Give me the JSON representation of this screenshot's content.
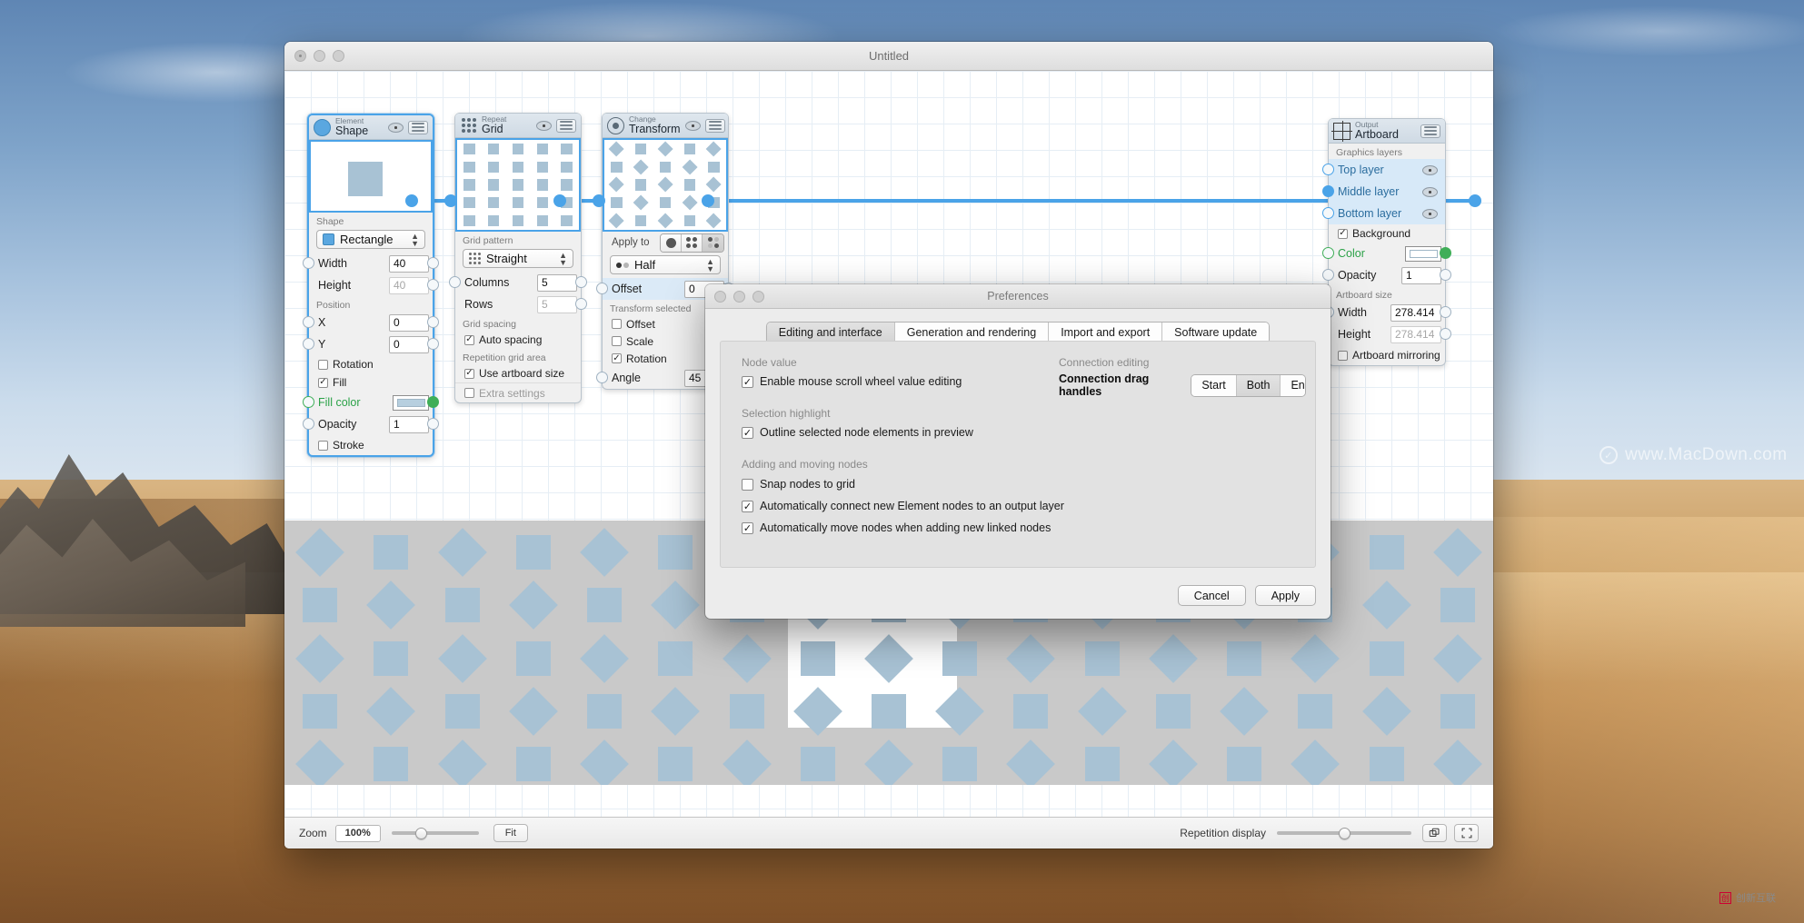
{
  "window": {
    "title": "Untitled",
    "traffic": [
      "close",
      "minimize",
      "zoom"
    ]
  },
  "nodes": [
    {
      "id": "element-shape",
      "kind": "Element",
      "name": "Shape",
      "icon": "circle-icon",
      "selected": true,
      "sections": [
        {
          "label": "Shape"
        }
      ],
      "popup": {
        "label": "Rectangle",
        "icon": "rectangle-swatch-icon"
      },
      "fields": [
        {
          "label": "Width",
          "value": "40",
          "dim": false
        },
        {
          "label": "Height",
          "value": "40",
          "dim": true
        }
      ],
      "position_label": "Position",
      "position_fields": [
        {
          "label": "X",
          "value": "0"
        },
        {
          "label": "Y",
          "value": "0"
        }
      ],
      "checks": [
        {
          "label": "Rotation",
          "checked": false,
          "dim": false
        },
        {
          "label": "Fill",
          "checked": true,
          "dim": false
        }
      ],
      "color_row": {
        "label": "Fill color",
        "green": true
      },
      "opacity_row": {
        "label": "Opacity",
        "value": "1"
      },
      "stroke_row": {
        "label": "Stroke",
        "checked": false
      }
    },
    {
      "id": "repeat-grid",
      "kind": "Repeat",
      "name": "Grid",
      "icon": "grid-dots-icon",
      "selected": false,
      "grid_pattern_label": "Grid pattern",
      "popup": {
        "label": "Straight",
        "icon": "dots-grid-icon"
      },
      "fields": [
        {
          "label": "Columns",
          "value": "5",
          "dim": false
        },
        {
          "label": "Rows",
          "value": "5",
          "dim": true
        }
      ],
      "grid_spacing_label": "Grid spacing",
      "auto_spacing": {
        "label": "Auto spacing",
        "checked": true
      },
      "repetition_area_label": "Repetition grid area",
      "use_artboard": {
        "label": "Use artboard size",
        "checked": true
      },
      "extra_settings": {
        "label": "Extra settings",
        "checked": false,
        "dim": true
      }
    },
    {
      "id": "change-transform",
      "kind": "Change",
      "name": "Transform",
      "icon": "transform-icon",
      "selected": false,
      "apply_to_label": "Apply to",
      "apply_to_options": [
        "all-dot-icon",
        "four-dots-icon",
        "half-dots-icon"
      ],
      "apply_to_selected_index": 2,
      "popup": {
        "label": "Half",
        "icon": "half-dots-icon"
      },
      "offset_row": {
        "label": "Offset",
        "value": "0"
      },
      "transform_selected_label": "Transform selected",
      "checks": [
        {
          "label": "Offset",
          "checked": false
        },
        {
          "label": "Scale",
          "checked": false
        },
        {
          "label": "Rotation",
          "checked": true
        }
      ],
      "angle_row": {
        "label": "Angle",
        "value": "45"
      }
    },
    {
      "id": "output-artboard",
      "kind": "Output",
      "name": "Artboard",
      "icon": "artboard-icon",
      "selected": false,
      "graphics_layers_label": "Graphics layers",
      "layers": [
        {
          "label": "Top layer",
          "active": false
        },
        {
          "label": "Middle layer",
          "active": true
        },
        {
          "label": "Bottom layer",
          "active": false
        }
      ],
      "background": {
        "label": "Background",
        "checked": true
      },
      "color_row": {
        "label": "Color",
        "green": true
      },
      "opacity_row": {
        "label": "Opacity",
        "value": "1"
      },
      "artboard_size_label": "Artboard size",
      "size_fields": [
        {
          "label": "Width",
          "value": "278.414",
          "dim": false
        },
        {
          "label": "Height",
          "value": "278.414",
          "dim": true
        }
      ],
      "mirroring": {
        "label": "Artboard mirroring",
        "checked": false
      }
    }
  ],
  "bottom_bar": {
    "zoom_label": "Zoom",
    "zoom_value": "100%",
    "fit_label": "Fit",
    "repetition_display_label": "Repetition display",
    "duplicate_icon": "duplicate-window-icon",
    "fullscreen_icon": "fullscreen-icon"
  },
  "preferences": {
    "title": "Preferences",
    "tabs": [
      {
        "label": "Editing and interface",
        "active": true
      },
      {
        "label": "Generation and rendering",
        "active": false
      },
      {
        "label": "Import and export",
        "active": false
      },
      {
        "label": "Software update",
        "active": false
      }
    ],
    "groups": {
      "node_value": "Node value",
      "connection_editing": "Connection editing",
      "selection_highlight": "Selection highlight",
      "adding_moving": "Adding and moving nodes"
    },
    "node_value_check": {
      "label": "Enable mouse scroll wheel value editing",
      "checked": true
    },
    "connection_drag_handles_label": "Connection drag handles",
    "connection_drag_handles_options": [
      {
        "label": "Start",
        "active": false
      },
      {
        "label": "Both",
        "active": true
      },
      {
        "label": "End",
        "active": false
      }
    ],
    "selection_highlight_check": {
      "label": "Outline selected node elements in preview",
      "checked": true
    },
    "adding_moving_checks": [
      {
        "label": "Snap nodes to grid",
        "checked": false
      },
      {
        "label": "Automatically connect new Element nodes to an output layer",
        "checked": true
      },
      {
        "label": "Automatically move nodes when adding new linked nodes",
        "checked": true
      }
    ],
    "buttons": [
      {
        "label": "Cancel",
        "primary": false
      },
      {
        "label": "Apply",
        "primary": false
      }
    ]
  },
  "watermarks": {
    "primary": "www.MacDown.com",
    "secondary": "创新互联"
  },
  "colors": {
    "accent": "#4aa3e8",
    "green_port": "#3fae58",
    "shape_fill": "#a8c2d4",
    "node_header": "#cfdae4"
  }
}
